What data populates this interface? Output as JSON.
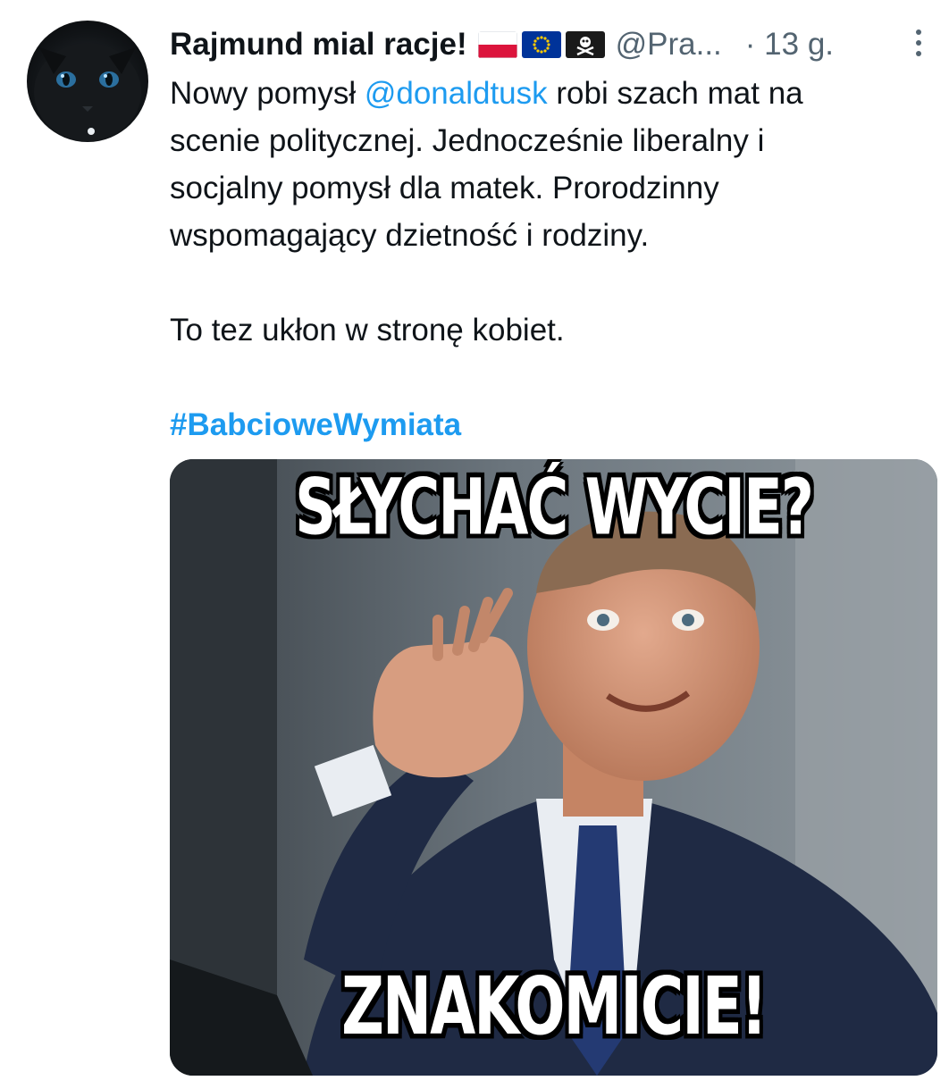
{
  "tweet": {
    "display_name": "Rajmund mial racje!",
    "flags": [
      "poland-flag",
      "eu-flag",
      "pirate-flag"
    ],
    "handle": "@Pra...",
    "time": "· 13 g.",
    "body": {
      "line1_prefix": "Nowy pomysł ",
      "mention": "@donaldtusk",
      "line1_suffix": " robi szach mat na",
      "line2": "scenie politycznej. Jednocześnie liberalny i",
      "line3": "socjalny pomysł dla matek. Prorodzinny",
      "line4": "wspomagający dzietność i rodziny.",
      "paragraph2": "To tez ukłon w stronę kobiet.",
      "hashtag": "#BabcioweWymiata"
    },
    "media": {
      "top_text": "SŁYCHAĆ WYCIE?",
      "bottom_text": "ZNAKOMICIE!"
    }
  },
  "colors": {
    "link": "#1d9bf0",
    "secondary": "#536471",
    "text": "#0f1419"
  },
  "icons": {
    "more": "more-vertical-icon"
  }
}
